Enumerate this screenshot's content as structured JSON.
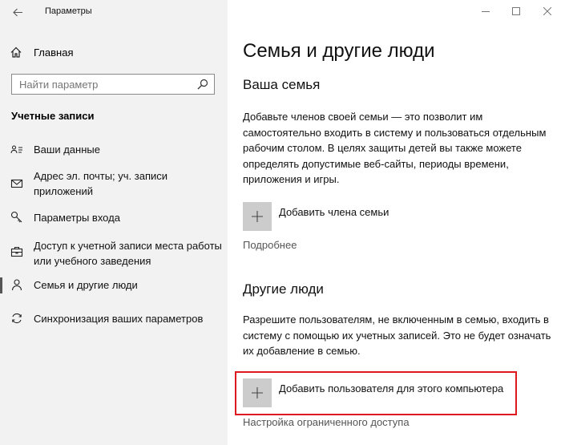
{
  "window": {
    "title": "Параметры",
    "controls": [
      "minimize-icon",
      "maximize-icon",
      "close-icon"
    ]
  },
  "sidebar": {
    "home_label": "Главная",
    "search_placeholder": "Найти параметр",
    "section_title": "Учетные записи",
    "items": [
      {
        "label": "Ваши данные",
        "icon": "contact-card-icon"
      },
      {
        "label": "Адрес эл. почты; уч. записи приложений",
        "icon": "mail-icon"
      },
      {
        "label": "Параметры входа",
        "icon": "key-icon"
      },
      {
        "label": "Доступ к учетной записи места работы или учебного заведения",
        "icon": "briefcase-icon"
      },
      {
        "label": "Семья и другие люди",
        "icon": "person-icon",
        "active": true
      },
      {
        "label": "Синхронизация ваших параметров",
        "icon": "sync-icon"
      }
    ]
  },
  "main": {
    "title": "Семья и другие люди",
    "family": {
      "heading": "Ваша семья",
      "description": "Добавьте членов своей семьи — это позволит им самостоятельно входить в систему и пользоваться отдельным рабочим столом. В целях защиты детей вы также можете определять допустимые веб-сайты, периоды времени, приложения и игры.",
      "add_label": "Добавить члена семьи",
      "more_link": "Подробнее"
    },
    "others": {
      "heading": "Другие люди",
      "description": "Разрешите пользователям, не включенным в семью, входить в систему с помощью их учетных записей. Это не будет означать их добавление в семью.",
      "add_label": "Добавить пользователя для этого компьютера",
      "restricted_link": "Настройка ограниченного доступа"
    }
  },
  "colors": {
    "sidebar_bg": "#f2f2f2",
    "plus_tile": "#cccccc",
    "highlight": "#e0191f"
  }
}
